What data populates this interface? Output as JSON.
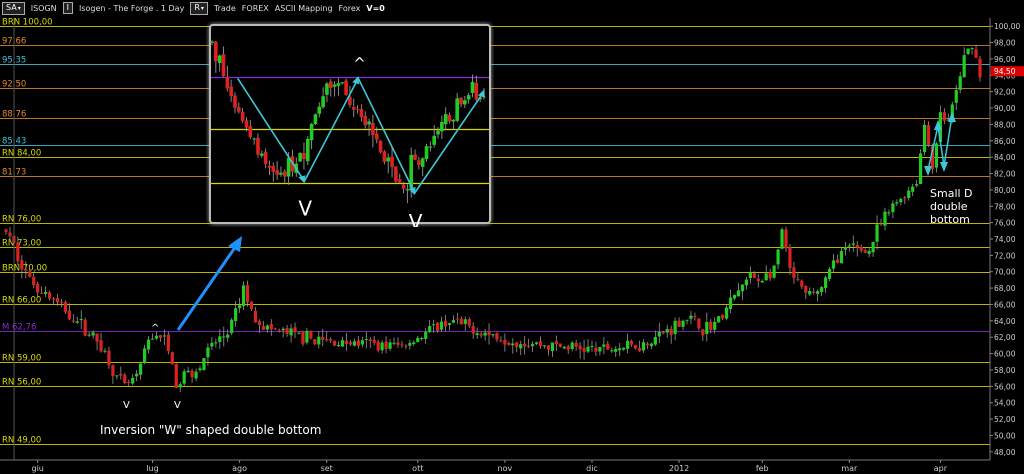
{
  "toolbar": {
    "period_btn": "SA",
    "symbol": "ISOGN",
    "info_btn": "I",
    "title": "Isogen - The Forge . 1 Day",
    "r_btn": "R",
    "mode": "Trade",
    "market": "FOREX",
    "mapping": "ASCII Mapping",
    "market2": "Forex",
    "version": "V=0"
  },
  "colors": {
    "background": "#000000",
    "up_candle": "#22cc22",
    "down_candle": "#dd2222",
    "line_yellow": "#d8d800",
    "line_orange": "#e08a2a",
    "line_cyan": "#3cc8d8",
    "line_purple": "#8a2ad8",
    "arrow_blue": "#1e90ff",
    "price_marker": "#e00000"
  },
  "chart_data": {
    "type": "candlestick",
    "ylim": [
      47,
      101
    ],
    "y_ticks": [
      "48,00",
      "50,00",
      "52,00",
      "54,00",
      "56,00",
      "58,00",
      "60,00",
      "62,00",
      "64,00",
      "66,00",
      "68,00",
      "70,00",
      "72,00",
      "74,00",
      "76,00",
      "78,00",
      "80,00",
      "82,00",
      "84,00",
      "86,00",
      "88,00",
      "90,00",
      "92,00",
      "94,00",
      "96,00",
      "98,00",
      "100,00"
    ],
    "x_ticks": [
      "giu",
      "lug",
      "ago",
      "set",
      "ott",
      "nov",
      "dic",
      "2012",
      "feb",
      "mar",
      "apr"
    ],
    "levels": [
      {
        "label": "BRN 100,00",
        "value": 100.0,
        "color": "yellow"
      },
      {
        "label": "97,66",
        "value": 97.66,
        "color": "orange"
      },
      {
        "label": "95,35",
        "value": 95.35,
        "color": "cyan"
      },
      {
        "label": "92,50",
        "value": 92.5,
        "color": "orange"
      },
      {
        "label": "88,76",
        "value": 88.76,
        "color": "orange"
      },
      {
        "label": "85,43",
        "value": 85.43,
        "color": "cyan"
      },
      {
        "label": "RN 84,00",
        "value": 84.0,
        "color": "yellow"
      },
      {
        "label": "81,73",
        "value": 81.73,
        "color": "orange"
      },
      {
        "label": "RN 76,00",
        "value": 76.0,
        "color": "yellow"
      },
      {
        "label": "RN 73,00",
        "value": 73.0,
        "color": "yellow"
      },
      {
        "label": "BRN 70,00",
        "value": 70.0,
        "color": "yellow"
      },
      {
        "label": "RN 66,00",
        "value": 66.0,
        "color": "yellow"
      },
      {
        "label": "M 62,76",
        "value": 62.76,
        "color": "purple"
      },
      {
        "label": "RN 59,00",
        "value": 59.0,
        "color": "yellow"
      },
      {
        "label": "RN 56,00",
        "value": 56.0,
        "color": "yellow"
      },
      {
        "label": "RN 49,00",
        "value": 49.0,
        "color": "yellow"
      }
    ],
    "anchor_path": [
      [
        0,
        75
      ],
      [
        6,
        69
      ],
      [
        12,
        66.5
      ],
      [
        18,
        64
      ],
      [
        24,
        61
      ],
      [
        28,
        57
      ],
      [
        30,
        56
      ],
      [
        33,
        57
      ],
      [
        36,
        61.5
      ],
      [
        38,
        62.5
      ],
      [
        40,
        61.5
      ],
      [
        42,
        59
      ],
      [
        43,
        55.5
      ],
      [
        45,
        57.5
      ],
      [
        48,
        58
      ],
      [
        52,
        61
      ],
      [
        56,
        62.5
      ],
      [
        59,
        66
      ],
      [
        60,
        68
      ],
      [
        62,
        65
      ],
      [
        66,
        63
      ],
      [
        80,
        61.5
      ],
      [
        100,
        61
      ],
      [
        112,
        64
      ],
      [
        124,
        62
      ],
      [
        136,
        61
      ],
      [
        150,
        60.5
      ],
      [
        160,
        61
      ],
      [
        166,
        62.5
      ],
      [
        172,
        64.5
      ],
      [
        176,
        63
      ],
      [
        180,
        64
      ],
      [
        184,
        67
      ],
      [
        188,
        69.5
      ],
      [
        190,
        69
      ],
      [
        194,
        70
      ],
      [
        196,
        75
      ],
      [
        198,
        70
      ],
      [
        202,
        67
      ],
      [
        206,
        68
      ],
      [
        210,
        72
      ],
      [
        214,
        73
      ],
      [
        218,
        72.5
      ],
      [
        220,
        75
      ],
      [
        224,
        78
      ],
      [
        228,
        80
      ],
      [
        230,
        81
      ],
      [
        232,
        88
      ],
      [
        234,
        83
      ],
      [
        236,
        89
      ],
      [
        238,
        88.5
      ],
      [
        240,
        92
      ],
      [
        242,
        96
      ],
      [
        244,
        98
      ],
      [
        246,
        94
      ]
    ],
    "last_price_label": "94,50",
    "annotations": [
      {
        "text": "Inversion \"W\" shaped double bottom"
      },
      {
        "text": "Small D double bottom"
      },
      {
        "text": "V"
      },
      {
        "text": "V"
      },
      {
        "text": "^"
      }
    ],
    "inset": {
      "levels": [
        {
          "value": 95.35,
          "color": "purple"
        },
        {
          "value": 88.76,
          "color": "yellow"
        },
        {
          "value": 81.73,
          "color": "yellow"
        }
      ],
      "ylim": [
        80.5,
        101
      ],
      "path": [
        [
          0,
          100
        ],
        [
          6,
          92
        ],
        [
          10,
          88
        ],
        [
          14,
          84
        ],
        [
          18,
          82.5
        ],
        [
          20,
          84
        ],
        [
          24,
          86
        ],
        [
          28,
          92
        ],
        [
          32,
          95.5
        ],
        [
          36,
          93
        ],
        [
          40,
          89
        ],
        [
          44,
          86
        ],
        [
          48,
          82
        ],
        [
          50,
          80.5
        ],
        [
          52,
          84
        ],
        [
          56,
          86
        ],
        [
          60,
          89
        ],
        [
          64,
          92
        ],
        [
          68,
          93.5
        ],
        [
          72,
          92
        ]
      ],
      "zig": [
        [
          10,
          95.2
        ],
        [
          36,
          82
        ],
        [
          57,
          95.2
        ],
        [
          79,
          80.5
        ],
        [
          106,
          93.5
        ]
      ],
      "labels": [
        {
          "text": "V"
        },
        {
          "text": "V"
        },
        {
          "text": "^"
        }
      ]
    }
  }
}
